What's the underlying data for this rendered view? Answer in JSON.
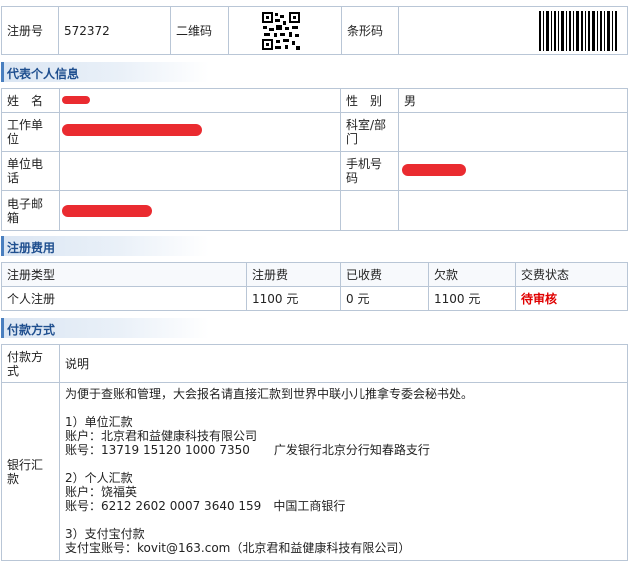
{
  "top": {
    "reg_no_label": "注册号",
    "reg_no_value": "572372",
    "qr_label": "二维码",
    "barcode_label": "条形码"
  },
  "personal": {
    "section_title": "代表个人信息",
    "name_label": "姓　名",
    "gender_label": "性　别",
    "gender_value": "男",
    "work_unit_label": "工作单位",
    "dept_label": "科室/部门",
    "work_phone_label": "单位电话",
    "mobile_label": "手机号码",
    "email_label": "电子邮箱"
  },
  "fees": {
    "section_title": "注册费用",
    "headers": [
      "注册类型",
      "注册费",
      "已收费",
      "欠款",
      "交费状态"
    ],
    "row": [
      "个人注册",
      "1100 元",
      "0 元",
      "1100 元",
      "待审核"
    ]
  },
  "payment": {
    "section_title": "付款方式",
    "method_header": "付款方式",
    "desc_header": "说明",
    "method_value": "银行汇款",
    "intro": "为便于查账和管理，大会报名请直接汇款到世界中联小儿推拿专委会秘书处。",
    "unit_title": "1）单位汇款",
    "unit_account_name": "账户：北京君和益健康科技有限公司",
    "unit_account_no": "账号：13719 15120 1000 7350　　广发银行北京分行知春路支行",
    "personal_title": "2）个人汇款",
    "personal_account_name": "账户：饶福英",
    "personal_account_no": "账号：6212 2602 0007 3640 159　中国工商银行",
    "alipay_title": "3）支付宝付款",
    "alipay_account": "支付宝账号：kovit@163.com（北京君和益健康科技有限公司）"
  },
  "colors": {
    "border": "#b9c6d6",
    "section_text": "#1f4f8f",
    "status_red": "#e00000",
    "redaction": "#e8191e"
  }
}
